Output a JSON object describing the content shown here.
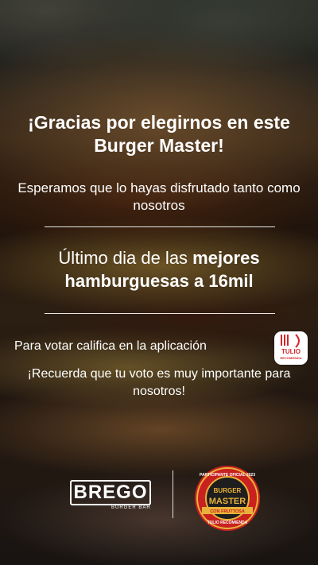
{
  "headline": "¡Gracias por elegirnos en este Burger Master!",
  "subtitle": "Esperamos que lo hayas disfrutado tanto como nosotros",
  "promo": {
    "prefix": "Último dia de las ",
    "bold": "mejores hamburguesas a 16mil"
  },
  "vote_text": "Para votar califica en la aplicación",
  "app_icon": {
    "name": "Tulio Recomienda",
    "brand": "TULIO",
    "tagline": "RECOMIENDA"
  },
  "reminder": "¡Recuerda que tu voto es muy importante para nosotros!",
  "footer": {
    "brego_logo": "BREGO",
    "brego_sub": "BURGER BAR",
    "badge_text": {
      "top": "PARTICIPANTE OFICIAL 2023",
      "middle1": "BURGER",
      "middle2": "MASTER",
      "ribbon": "CON FRUTTOSA",
      "bottom": "TULIO RECOMIENDA"
    }
  },
  "colors": {
    "badge_red": "#c8211f",
    "badge_gold": "#e8b23a",
    "app_red": "#d3262a"
  }
}
